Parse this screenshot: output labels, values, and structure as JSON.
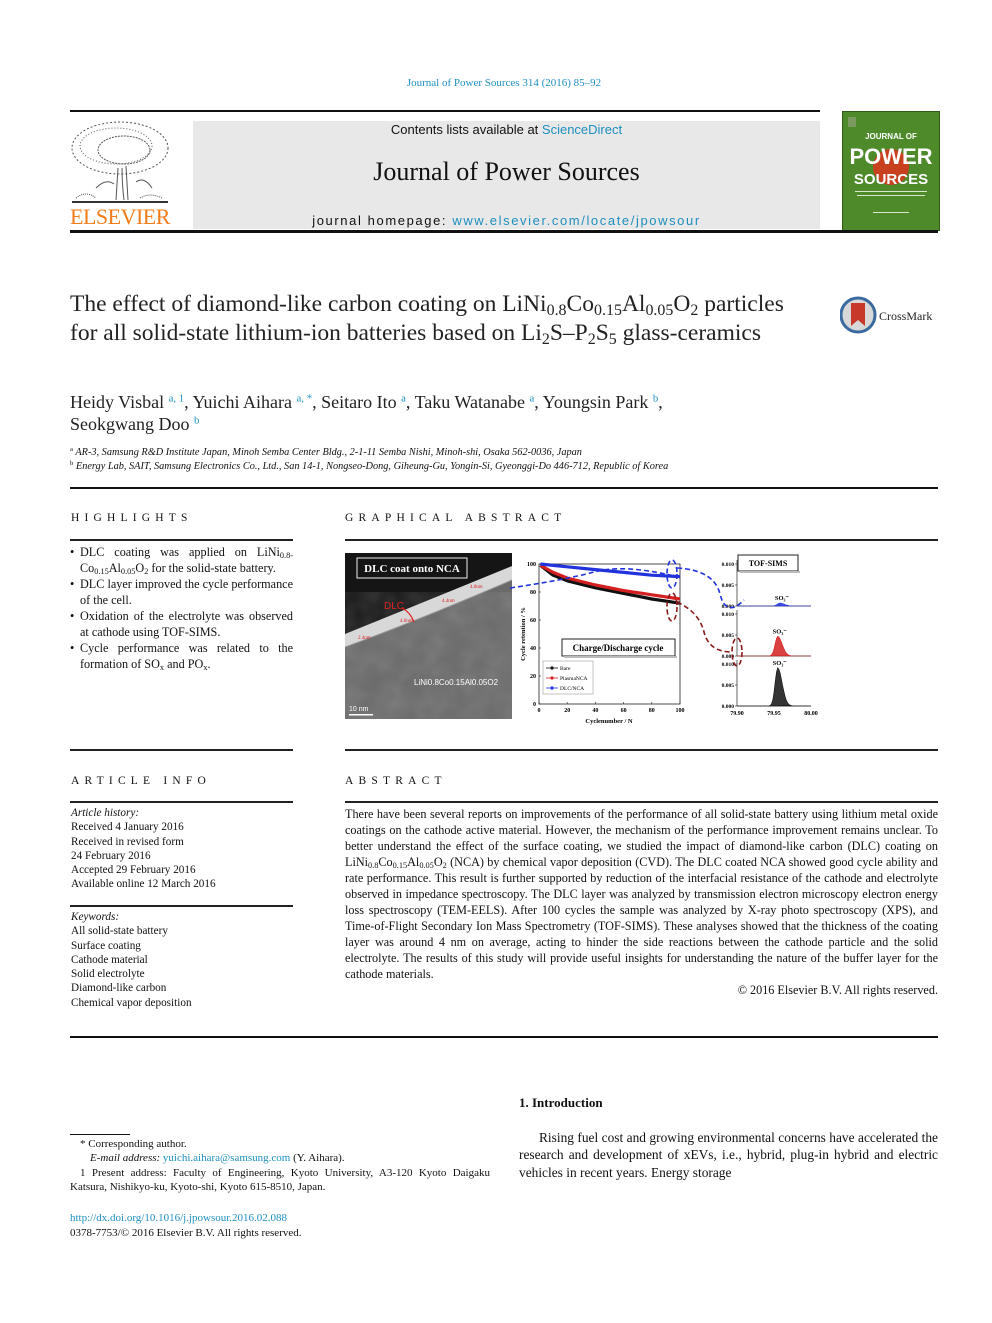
{
  "header": {
    "citation": "Journal of Power Sources 314 (2016) 85–92",
    "contents_prefix": "Contents lists available at ",
    "contents_link": "ScienceDirect",
    "journal_title": "Journal of Power Sources",
    "homepage_prefix": "journal homepage: ",
    "homepage_link": "www.elsevier.com/locate/jpowsour",
    "publisher_logo_text": "ELSEVIER",
    "cover": {
      "line1": "JOURNAL OF",
      "line2": "POWER",
      "line3": "SOURCES",
      "bg_color": "#4e8a2a",
      "accent_color": "#c8401e"
    }
  },
  "article": {
    "title_parts": {
      "p1": "The effect of diamond-like carbon coating on LiNi",
      "s1": "0.8",
      "p2": "Co",
      "s2": "0.15",
      "p3": "Al",
      "s3": "0.05",
      "p4": "O",
      "s4": "2",
      "p5": " particles for all solid-state lithium-ion batteries based on Li",
      "s5": "2",
      "p6": "S–P",
      "s6": "2",
      "p7": "S",
      "s7": "5",
      "p8": " glass-ceramics"
    },
    "crossmark_label": "CrossMark",
    "authors": [
      {
        "name": "Heidy Visbal",
        "marks": "a, 1",
        "sep": ", "
      },
      {
        "name": "Yuichi Aihara",
        "marks": "a, *",
        "sep": ", "
      },
      {
        "name": "Seitaro Ito",
        "marks": "a",
        "sep": ", "
      },
      {
        "name": "Taku Watanabe",
        "marks": "a",
        "sep": ", "
      },
      {
        "name": "Youngsin Park",
        "marks": "b",
        "sep": ","
      },
      {
        "name": "Seokgwang Doo",
        "marks": "b",
        "sep": ""
      }
    ],
    "affiliations": [
      {
        "mark": "a",
        "text": "AR-3, Samsung R&D Institute Japan, Minoh Semba Center Bldg., 2-1-11 Semba Nishi, Minoh-shi, Osaka 562-0036, Japan"
      },
      {
        "mark": "b",
        "text": "Energy Lab, SAIT, Samsung Electronics Co., Ltd., San 14-1, Nongseo-Dong, Giheung-Gu, Yongin-Si, Gyeonggi-Do 446-712, Republic of Korea"
      }
    ]
  },
  "highlights": {
    "heading": "HIGHLIGHTS",
    "item1": {
      "a": "DLC coating was applied on LiNi",
      "s1": "0.8-",
      "b": "Co",
      "s2": "0.15",
      "c": "Al",
      "s3": "0.05",
      "d": "O",
      "s4": "2",
      "e": " for the solid-state battery."
    },
    "item2": "DLC layer improved the cycle performance of the cell.",
    "item3": "Oxidation of the electrolyte was observed at cathode using TOF-SIMS.",
    "item4": {
      "a": "Cycle performance was related to the formation of SO",
      "s1": "x",
      "b": " and PO",
      "s2": "x",
      "c": "."
    }
  },
  "graphical_abstract": {
    "heading": "GRAPHICAL ABSTRACT",
    "tem_label": "DLC coat onto NCA",
    "dlc_label": "DLC",
    "material_label": "LiNi0.8Co0.15Al0.05O2",
    "scale_bar": "10 nm",
    "thickness_labels": [
      "4.0nm",
      "4.4nm",
      "4.0nm",
      "2.4nm"
    ],
    "cycle_chart": {
      "type": "line",
      "title": "Charge/Discharge cycle",
      "xlabel": "Cyclenumber / N",
      "ylabel": "Cycle retention / %",
      "xlim": [
        0,
        100
      ],
      "ylim": [
        0,
        100
      ],
      "xticks": [
        0,
        20,
        40,
        60,
        80,
        100
      ],
      "yticks": [
        0,
        20,
        40,
        60,
        80,
        100
      ],
      "series": [
        {
          "name": "Bare",
          "color": "#111111",
          "x": [
            1,
            10,
            20,
            40,
            60,
            80,
            100
          ],
          "values": [
            99,
            92,
            88,
            83,
            79,
            75,
            72
          ]
        },
        {
          "name": "PlasmaNCA",
          "color": "#d42020",
          "x": [
            1,
            10,
            20,
            40,
            60,
            80,
            100
          ],
          "values": [
            99,
            94,
            90,
            85,
            81,
            78,
            75
          ]
        },
        {
          "name": "DLC/NCA",
          "color": "#2233dd",
          "x": [
            1,
            10,
            20,
            40,
            60,
            80,
            100
          ],
          "values": [
            100,
            99,
            98,
            96,
            94,
            92,
            91
          ]
        }
      ]
    },
    "tof_sims": {
      "type": "area",
      "title": "TOF-SIMS",
      "xticks": [
        "79.90",
        "79.95",
        "80.00"
      ],
      "yticks": [
        "0.000",
        "0.005",
        "0.010"
      ],
      "xlim": [
        79.9,
        80.0
      ],
      "ylim": [
        0,
        0.01
      ],
      "peak_label": "SO3-",
      "panels": [
        {
          "name": "DLC/NCA",
          "color": "#2233dd",
          "peak_center": 79.958,
          "peak_height": 0.0007
        },
        {
          "name": "PlasmaNCA",
          "color": "#d42020",
          "peak_center": 79.955,
          "peak_height": 0.0047
        },
        {
          "name": "Bare",
          "color": "#111111",
          "peak_center": 79.955,
          "peak_height": 0.0091
        }
      ]
    }
  },
  "article_info": {
    "heading": "ARTICLE INFO",
    "history_label": "Article history:",
    "history": [
      "Received 4 January 2016",
      "Received in revised form",
      "24 February 2016",
      "Accepted 29 February 2016",
      "Available online 12 March 2016"
    ],
    "keywords_label": "Keywords:",
    "keywords": [
      "All solid-state battery",
      "Surface coating",
      "Cathode material",
      "Solid electrolyte",
      "Diamond-like carbon",
      "Chemical vapor deposition"
    ]
  },
  "abstract": {
    "heading": "ABSTRACT",
    "p1": "There have been several reports on improvements of the performance of all solid-state battery using lithium metal oxide coatings on the cathode active material. However, the mechanism of the performance improvement remains unclear. To better understand the effect of the surface coating, we studied the impact of diamond-like carbon (DLC) coating on LiNi",
    "s1": "0.8",
    "p2": "Co",
    "s2": "0.15",
    "p3": "Al",
    "s3": "0.05",
    "p4": "O",
    "s4": "2",
    "p5": " (NCA) by chemical vapor deposition (CVD). The DLC coated NCA showed good cycle ability and rate performance. This result is further supported by reduction of the interfacial resistance of the cathode and electrolyte observed in impedance spectroscopy. The DLC layer was analyzed by transmission electron microscopy electron energy loss spectroscopy (TEM-EELS). After 100 cycles the sample was analyzed by X-ray photo spectroscopy (XPS), and Time-of-Flight Secondary Ion Mass Spectrometry (TOF-SIMS). These analyses showed that the thickness of the coating layer was around 4 nm on average, acting to hinder the side reactions between the cathode particle and the solid electrolyte. The results of this study will provide useful insights for understanding the nature of the buffer layer for the cathode materials.",
    "copyright": "© 2016 Elsevier B.V. All rights reserved."
  },
  "introduction": {
    "heading": "1.  Introduction",
    "text": "Rising fuel cost and growing environmental concerns have accelerated the research and development of xEVs, i.e., hybrid, plug-in hybrid and electric vehicles in recent years. Energy storage"
  },
  "footnotes": {
    "corresponding": "*  Corresponding author.",
    "email_label": "E-mail address: ",
    "email": "yuichi.aihara@samsung.com",
    "email_suffix": " (Y. Aihara).",
    "present_address": "1  Present address: Faculty of Engineering, Kyoto University, A3-120 Kyoto Daigaku Katsura, Nishikyo-ku, Kyoto-shi, Kyoto 615-8510, Japan.",
    "doi": "http://dx.doi.org/10.1016/j.jpowsour.2016.02.088",
    "issn": "0378-7753/© 2016 Elsevier B.V. All rights reserved."
  }
}
